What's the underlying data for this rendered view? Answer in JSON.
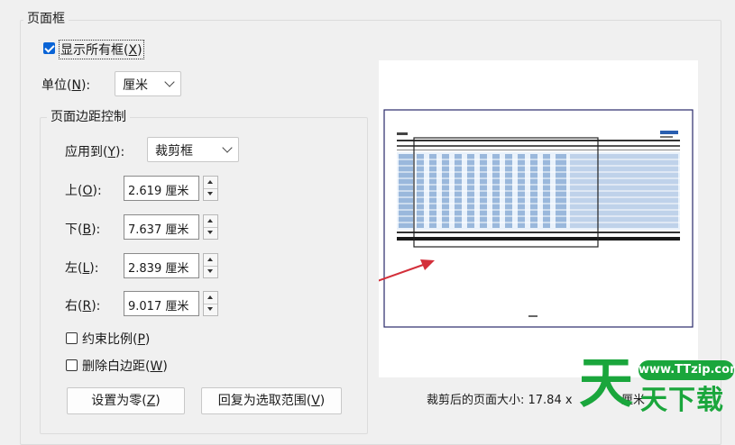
{
  "page_frame": {
    "title": "页面框",
    "show_all": {
      "label": "显示所有框",
      "key": "X",
      "checked": true
    },
    "unit": {
      "label": "单位",
      "key": "N",
      "value": "厘米"
    }
  },
  "margin_control": {
    "title": "页面边距控制",
    "apply_to": {
      "label": "应用到",
      "key": "Y",
      "value": "裁剪框"
    },
    "fields": [
      {
        "label": "上",
        "key": "O",
        "value": "2.619 厘米"
      },
      {
        "label": "下",
        "key": "B",
        "value": "7.637 厘米"
      },
      {
        "label": "左",
        "key": "L",
        "value": "2.839 厘米"
      },
      {
        "label": "右",
        "key": "R",
        "value": "9.017 厘米"
      }
    ],
    "constrain": {
      "label": "约束比例",
      "key": "P",
      "checked": false
    },
    "remove_white": {
      "label": "删除白边距",
      "key": "W",
      "checked": false
    },
    "btn_zero": {
      "label": "设置为零",
      "key": "Z"
    },
    "btn_restore": {
      "label": "回复为选取范围",
      "key": "V"
    }
  },
  "preview": {
    "size_label": "裁剪后的页面大小: 17.84 x",
    "size_tail": "厘米"
  },
  "watermark": {
    "url": "www.TTzip.com",
    "logo_char": "天",
    "text": "天下载"
  },
  "colors": {
    "accent": "#0a64d6",
    "page_border": "#2a2a6a",
    "arrow": "#d32f3a",
    "watermark_green": "#1aa63c"
  }
}
